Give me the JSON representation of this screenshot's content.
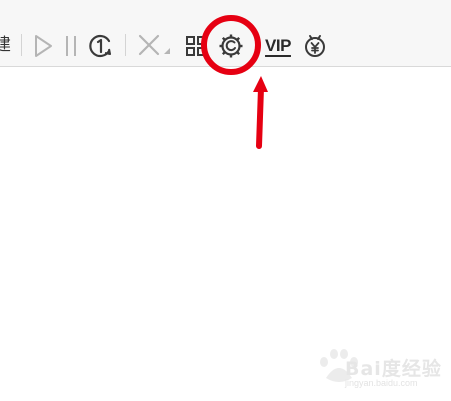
{
  "toolbar": {
    "partial_label": "建",
    "vip_label": "VIP",
    "icons": {
      "start": "play-icon",
      "pause": "pause-icon",
      "speed_limit": "speed-limit-1-icon",
      "delete": "delete-x-icon",
      "grid": "grid-view-icon",
      "settings": "settings-gear-icon",
      "vip": "vip-icon",
      "coin": "yuan-coin-icon"
    }
  },
  "annotation": {
    "highlight_color": "#e60012",
    "target": "settings-gear-icon"
  },
  "watermark": {
    "text": "Bai度经验",
    "subtext": "jingyan.baidu.com"
  }
}
